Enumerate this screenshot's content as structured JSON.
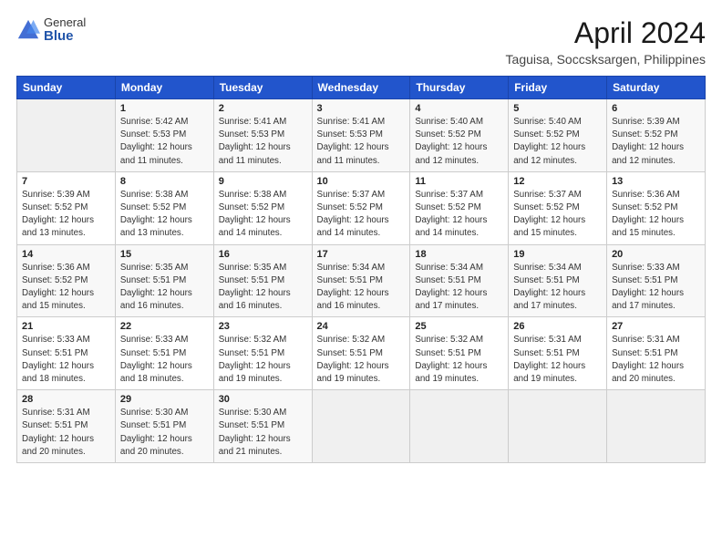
{
  "logo": {
    "general": "General",
    "blue": "Blue"
  },
  "title": "April 2024",
  "subtitle": "Taguisa, Soccsksargen, Philippines",
  "headers": [
    "Sunday",
    "Monday",
    "Tuesday",
    "Wednesday",
    "Thursday",
    "Friday",
    "Saturday"
  ],
  "weeks": [
    [
      {
        "day": "",
        "info": ""
      },
      {
        "day": "1",
        "info": "Sunrise: 5:42 AM\nSunset: 5:53 PM\nDaylight: 12 hours\nand 11 minutes."
      },
      {
        "day": "2",
        "info": "Sunrise: 5:41 AM\nSunset: 5:53 PM\nDaylight: 12 hours\nand 11 minutes."
      },
      {
        "day": "3",
        "info": "Sunrise: 5:41 AM\nSunset: 5:53 PM\nDaylight: 12 hours\nand 11 minutes."
      },
      {
        "day": "4",
        "info": "Sunrise: 5:40 AM\nSunset: 5:52 PM\nDaylight: 12 hours\nand 12 minutes."
      },
      {
        "day": "5",
        "info": "Sunrise: 5:40 AM\nSunset: 5:52 PM\nDaylight: 12 hours\nand 12 minutes."
      },
      {
        "day": "6",
        "info": "Sunrise: 5:39 AM\nSunset: 5:52 PM\nDaylight: 12 hours\nand 12 minutes."
      }
    ],
    [
      {
        "day": "7",
        "info": "Sunrise: 5:39 AM\nSunset: 5:52 PM\nDaylight: 12 hours\nand 13 minutes."
      },
      {
        "day": "8",
        "info": "Sunrise: 5:38 AM\nSunset: 5:52 PM\nDaylight: 12 hours\nand 13 minutes."
      },
      {
        "day": "9",
        "info": "Sunrise: 5:38 AM\nSunset: 5:52 PM\nDaylight: 12 hours\nand 14 minutes."
      },
      {
        "day": "10",
        "info": "Sunrise: 5:37 AM\nSunset: 5:52 PM\nDaylight: 12 hours\nand 14 minutes."
      },
      {
        "day": "11",
        "info": "Sunrise: 5:37 AM\nSunset: 5:52 PM\nDaylight: 12 hours\nand 14 minutes."
      },
      {
        "day": "12",
        "info": "Sunrise: 5:37 AM\nSunset: 5:52 PM\nDaylight: 12 hours\nand 15 minutes."
      },
      {
        "day": "13",
        "info": "Sunrise: 5:36 AM\nSunset: 5:52 PM\nDaylight: 12 hours\nand 15 minutes."
      }
    ],
    [
      {
        "day": "14",
        "info": "Sunrise: 5:36 AM\nSunset: 5:52 PM\nDaylight: 12 hours\nand 15 minutes."
      },
      {
        "day": "15",
        "info": "Sunrise: 5:35 AM\nSunset: 5:51 PM\nDaylight: 12 hours\nand 16 minutes."
      },
      {
        "day": "16",
        "info": "Sunrise: 5:35 AM\nSunset: 5:51 PM\nDaylight: 12 hours\nand 16 minutes."
      },
      {
        "day": "17",
        "info": "Sunrise: 5:34 AM\nSunset: 5:51 PM\nDaylight: 12 hours\nand 16 minutes."
      },
      {
        "day": "18",
        "info": "Sunrise: 5:34 AM\nSunset: 5:51 PM\nDaylight: 12 hours\nand 17 minutes."
      },
      {
        "day": "19",
        "info": "Sunrise: 5:34 AM\nSunset: 5:51 PM\nDaylight: 12 hours\nand 17 minutes."
      },
      {
        "day": "20",
        "info": "Sunrise: 5:33 AM\nSunset: 5:51 PM\nDaylight: 12 hours\nand 17 minutes."
      }
    ],
    [
      {
        "day": "21",
        "info": "Sunrise: 5:33 AM\nSunset: 5:51 PM\nDaylight: 12 hours\nand 18 minutes."
      },
      {
        "day": "22",
        "info": "Sunrise: 5:33 AM\nSunset: 5:51 PM\nDaylight: 12 hours\nand 18 minutes."
      },
      {
        "day": "23",
        "info": "Sunrise: 5:32 AM\nSunset: 5:51 PM\nDaylight: 12 hours\nand 19 minutes."
      },
      {
        "day": "24",
        "info": "Sunrise: 5:32 AM\nSunset: 5:51 PM\nDaylight: 12 hours\nand 19 minutes."
      },
      {
        "day": "25",
        "info": "Sunrise: 5:32 AM\nSunset: 5:51 PM\nDaylight: 12 hours\nand 19 minutes."
      },
      {
        "day": "26",
        "info": "Sunrise: 5:31 AM\nSunset: 5:51 PM\nDaylight: 12 hours\nand 19 minutes."
      },
      {
        "day": "27",
        "info": "Sunrise: 5:31 AM\nSunset: 5:51 PM\nDaylight: 12 hours\nand 20 minutes."
      }
    ],
    [
      {
        "day": "28",
        "info": "Sunrise: 5:31 AM\nSunset: 5:51 PM\nDaylight: 12 hours\nand 20 minutes."
      },
      {
        "day": "29",
        "info": "Sunrise: 5:30 AM\nSunset: 5:51 PM\nDaylight: 12 hours\nand 20 minutes."
      },
      {
        "day": "30",
        "info": "Sunrise: 5:30 AM\nSunset: 5:51 PM\nDaylight: 12 hours\nand 21 minutes."
      },
      {
        "day": "",
        "info": ""
      },
      {
        "day": "",
        "info": ""
      },
      {
        "day": "",
        "info": ""
      },
      {
        "day": "",
        "info": ""
      }
    ]
  ]
}
